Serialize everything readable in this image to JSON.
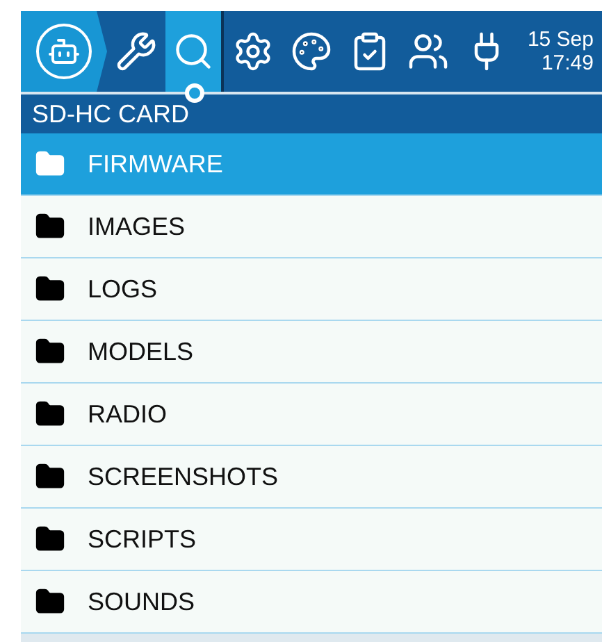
{
  "top_bar": {
    "tabs": [
      {
        "kind": "home",
        "selected": false
      },
      {
        "kind": "tools",
        "selected": false
      },
      {
        "kind": "sdcard",
        "selected": true
      },
      {
        "kind": "settings",
        "selected": false
      },
      {
        "kind": "theme",
        "selected": false
      },
      {
        "kind": "checklist",
        "selected": false
      },
      {
        "kind": "users",
        "selected": false
      },
      {
        "kind": "plug",
        "selected": false
      }
    ],
    "date": "15 Sep",
    "time": "17:49"
  },
  "title": "SD-HC CARD",
  "files": [
    {
      "name": "FIRMWARE",
      "selected": true
    },
    {
      "name": "IMAGES",
      "selected": false
    },
    {
      "name": "LOGS",
      "selected": false
    },
    {
      "name": "MODELS",
      "selected": false
    },
    {
      "name": "RADIO",
      "selected": false
    },
    {
      "name": "SCREENSHOTS",
      "selected": false
    },
    {
      "name": "SCRIPTS",
      "selected": false
    },
    {
      "name": "SOUNDS",
      "selected": false
    }
  ]
}
